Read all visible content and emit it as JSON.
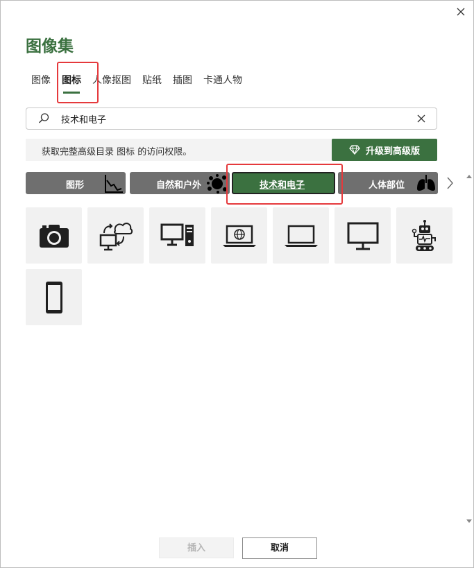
{
  "dialog": {
    "title": "图像集"
  },
  "tabs": [
    {
      "label": "图像"
    },
    {
      "label": "图标"
    },
    {
      "label": "人像抠图"
    },
    {
      "label": "贴纸"
    },
    {
      "label": "插图"
    },
    {
      "label": "卡通人物"
    }
  ],
  "active_tab": "图标",
  "search": {
    "value": "技术和电子"
  },
  "banner": {
    "text": "获取完整高级目录 图标 的访问权限。",
    "upgrade_label": "升级到高级版"
  },
  "categories": [
    {
      "label": "图形"
    },
    {
      "label": "自然和户外"
    },
    {
      "label": "技术和电子"
    },
    {
      "label": "人体部位"
    }
  ],
  "active_category": "技术和电子",
  "icons": [
    {
      "name": "camera-icon"
    },
    {
      "name": "computer-cloud-sync-icon"
    },
    {
      "name": "desktop-computer-icon"
    },
    {
      "name": "laptop-globe-icon"
    },
    {
      "name": "laptop-icon"
    },
    {
      "name": "monitor-icon"
    },
    {
      "name": "robot-icon"
    },
    {
      "name": "smartphone-icon"
    }
  ],
  "buttons": {
    "insert": "插入",
    "cancel": "取消"
  },
  "colors": {
    "accent": "#3b7140",
    "highlight": "#e5393c",
    "category_bg": "#6f6f6f"
  }
}
